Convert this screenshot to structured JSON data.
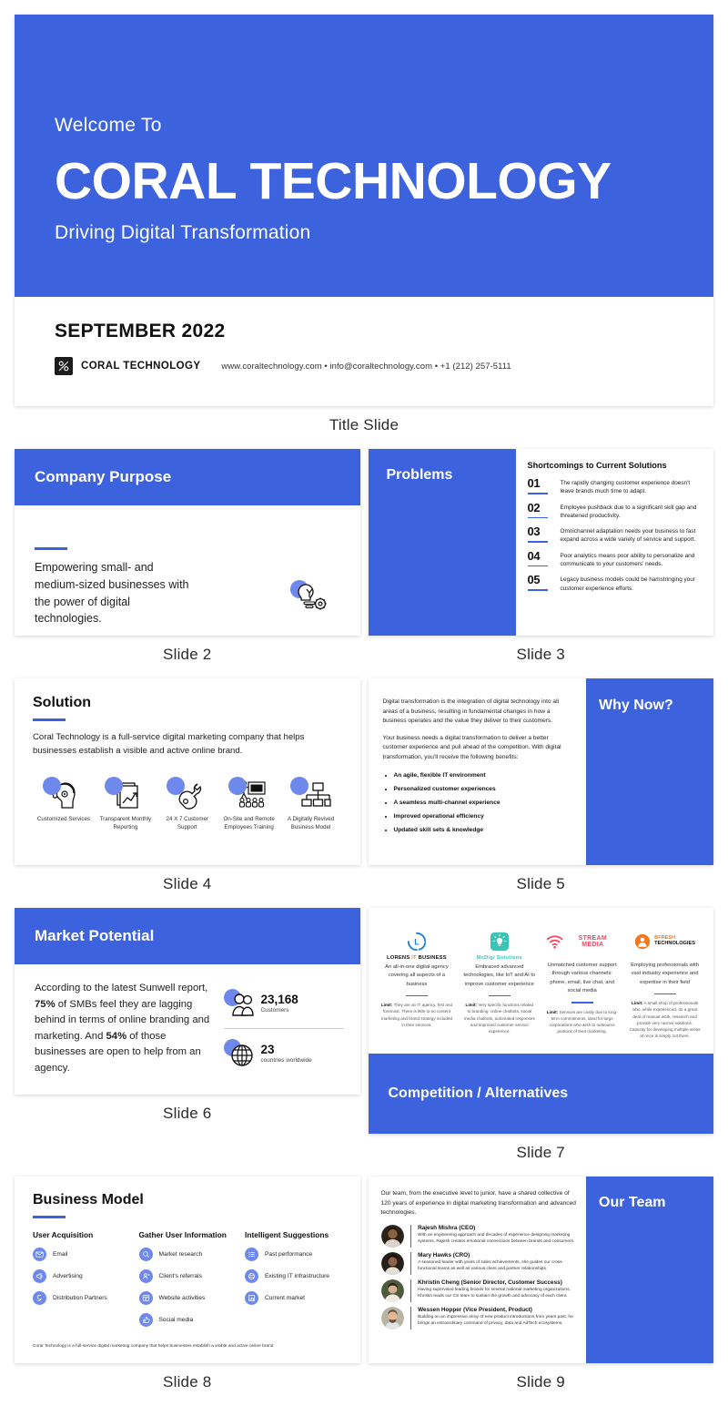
{
  "brand": {
    "blue": "#3c62dd",
    "light_blue": "#6e88ec",
    "dark": "#111111"
  },
  "captions": {
    "title": "Title Slide",
    "s2": "Slide 2",
    "s3": "Slide 3",
    "s4": "Slide 4",
    "s5": "Slide 5",
    "s6": "Slide 6",
    "s7": "Slide 7",
    "s8": "Slide 8",
    "s9": "Slide 9"
  },
  "title_slide": {
    "welcome": "Welcome To",
    "company": "CORAL TECHNOLOGY",
    "tagline": "Driving Digital Transformation",
    "date": "SEPTEMBER 2022",
    "logo_name": "CORAL TECHNOLOGY",
    "contact": "www.coraltechnology.com • info@coraltechnology.com • +1 (212) 257-5111"
  },
  "slide2": {
    "heading": "Company Purpose",
    "body": "Empowering small- and medium-sized businesses with the power of digital technologies."
  },
  "slide3": {
    "heading": "Problems",
    "subheading": "Shortcomings to Current Solutions",
    "items": [
      {
        "num": "01",
        "text": "The rapidly changing customer experience doesn't leave brands much time to adapt."
      },
      {
        "num": "02",
        "text": "Employee pushback due to a significant skill gap and threatened productivity."
      },
      {
        "num": "03",
        "text": "Omnichannel adaptation needs your business to fast expand across a wide variety of service and support."
      },
      {
        "num": "04",
        "text": "Poor analytics means poor ability to personalize and communicate to your customers' needs."
      },
      {
        "num": "05",
        "text": "Legacy business models could be hamstringing your customer experience efforts."
      }
    ]
  },
  "slide4": {
    "heading": "Solution",
    "body": "Coral Technology is a full-service digital marketing company that helps businesses establish a visible and active online brand.",
    "features": [
      {
        "label": "Customized Services",
        "icon": "headset-head-icon"
      },
      {
        "label": "Transparent Monthly Reporting",
        "icon": "report-chart-icon"
      },
      {
        "label": "24 X 7 Customer Support",
        "icon": "support-wrench-icon"
      },
      {
        "label": "On-Site and Remote Employees Training",
        "icon": "training-board-icon"
      },
      {
        "label": "A Digitally Revived Business Model",
        "icon": "org-chart-icon"
      }
    ]
  },
  "slide5": {
    "heading": "Why Now?",
    "paragraphs": [
      "Digital transformation is the integration of digital technology into all areas of a business, resulting in fundamental changes in how a business operates and the value they deliver to their customers.",
      "Your business needs a digital transformation to deliver a better customer experience and pull ahead of the competition. With digital transformation, you'll receive the following benefits:"
    ],
    "benefits": [
      "An agile, flexible IT environment",
      "Personalized customer experiences",
      "A seamless multi-channel experience",
      "Improved operational efficiency",
      "Updated skill sets & knowledge"
    ]
  },
  "slide6": {
    "heading": "Market Potential",
    "body_parts": [
      "According to the latest Sunwell report, ",
      "75%",
      " of SMBs feel they are lagging behind in terms of online branding and marketing. And ",
      "54%",
      " of those businesses are open to help from an agency."
    ],
    "stats": [
      {
        "value": "23,168",
        "label": "Customers",
        "icon": "people-icon"
      },
      {
        "value": "23",
        "label": "countries worldwide",
        "icon": "globe-icon"
      }
    ]
  },
  "slide7": {
    "heading": "Competition / Alternatives",
    "competitors": [
      {
        "name_a": "LORENS",
        "name_b": "IT",
        "name_c": "BUSINESS",
        "color": "#1b7fd4",
        "icon": "clock-l-icon",
        "desc": "An all-in-one digital agency covering all aspects of a business",
        "limit_label": "Limit:",
        "limit": "They are an IT agency, first and foremost. There is little to no content marketing and brand strategy included in their services."
      },
      {
        "name_a": "McDigi Solutions",
        "name_b": "",
        "name_c": "",
        "color": "#3bc4b5",
        "icon": "lightbulb-square-icon",
        "desc": "Embraced advanced technologies, like IoT and AI to improve customer experience",
        "limit_label": "Limit:",
        "limit": "Very specific functions related to branding: online chatbots, social media chatbots, automated responses and improved customer service experience."
      },
      {
        "name_a": "STREAM MEDIA",
        "name_b": "",
        "name_c": "",
        "color": "#f3455e",
        "icon": "wifi-signal-icon",
        "desc": "Unmatched customer support through various channels: phone, email, live chat, and social media",
        "limit_label": "Limit:",
        "limit": "Services are costly due to long-term commitments, ideal for large corporations who wish to outsource portions of their marketing."
      },
      {
        "name_a": "BFRESH",
        "name_b": "TECHNOLOGIES",
        "name_c": "",
        "color": "#f07922",
        "icon": "person-badge-icon",
        "desc": "Employing professionals with vast industry experience and expertise in their field",
        "limit_label": "Limit:",
        "limit": "A small shop of professionals who, while experienced, do a great deal of manual work, research and provide very narrow solutions. Capacity for developing multiple areas at once is simply not there."
      }
    ]
  },
  "slide8": {
    "heading": "Business Model",
    "columns": [
      {
        "header": "User Acquisition",
        "items": [
          {
            "label": "Email",
            "icon": "envelope-icon"
          },
          {
            "label": "Advertising",
            "icon": "megaphone-icon"
          },
          {
            "label": "Distribution Partners",
            "icon": "share-icon"
          }
        ]
      },
      {
        "header": "Gather User Information",
        "items": [
          {
            "label": "Market research",
            "icon": "search-icon"
          },
          {
            "label": "Client's referrals",
            "icon": "person-refer-icon"
          },
          {
            "label": "Website activities",
            "icon": "browser-icon"
          },
          {
            "label": "Social media",
            "icon": "thumbs-up-icon"
          }
        ]
      },
      {
        "header": "Intelligent Suggestions",
        "items": [
          {
            "label": "Past performance",
            "icon": "list-icon"
          },
          {
            "label": "Existing IT infrastructure",
            "icon": "server-icon"
          },
          {
            "label": "Current market",
            "icon": "dashboard-icon"
          }
        ]
      }
    ],
    "footer": "Coral Technology is a full-service digital marketing company that helps businesses establish a visible and active online brand"
  },
  "slide9": {
    "heading": "Our Team",
    "intro": "Our team, from the executive level to junior, have a shared collective of 120 years of experience in digital marketing transformation and advanced technologies.",
    "members": [
      {
        "name": "Rajesh Mishra (CEO)",
        "bio": "With an engineering approach and decades of experience designing marketing systems, Rajesh creates emotional connections between brands and consumers.",
        "avatar_tone": "#4a3a2f"
      },
      {
        "name": "Mary Hawks (CRO)",
        "bio": "A seasoned leader with years of sales achievements, she guides our cross-functional teams as well as various client and partner relationships.",
        "avatar_tone": "#3f3128"
      },
      {
        "name": "Khristin Cheng (Senior Director, Customer Success)",
        "bio": "Having supervised leading brands for several national marketing organizations, Khristin leads our CS team to sustain the growth and advocacy of each client.",
        "avatar_tone": "#5a6a4a"
      },
      {
        "name": "Wessen Hopper (Vice President, Product)",
        "bio": "Building on an impressive array of new product introductions from years past, he brings an extraordinary command of privacy, data and AdTech ecosystems.",
        "avatar_tone": "#7b7263"
      }
    ]
  }
}
